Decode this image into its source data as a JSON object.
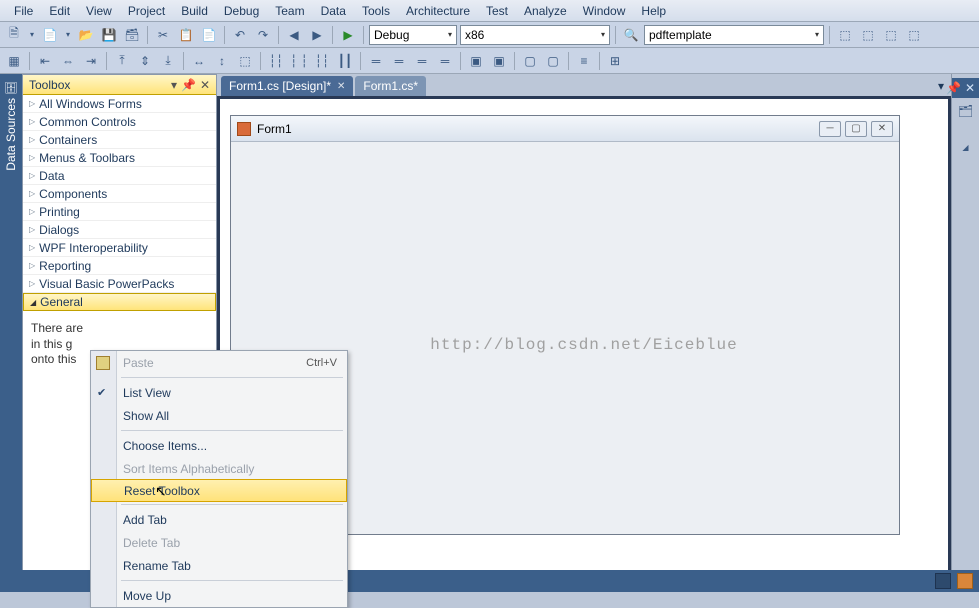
{
  "menu": {
    "items": [
      "File",
      "Edit",
      "View",
      "Project",
      "Build",
      "Debug",
      "Team",
      "Data",
      "Tools",
      "Architecture",
      "Test",
      "Analyze",
      "Window",
      "Help"
    ]
  },
  "toolbar": {
    "config": "Debug",
    "platform": "x86",
    "find": "pdftemplate"
  },
  "side_tab": {
    "label": "Data Sources"
  },
  "toolbox": {
    "title": "Toolbox",
    "categories": [
      "All Windows Forms",
      "Common Controls",
      "Containers",
      "Menus & Toolbars",
      "Data",
      "Components",
      "Printing",
      "Dialogs",
      "WPF Interoperability",
      "Reporting",
      "Visual Basic PowerPacks",
      "General"
    ],
    "empty_msg_1": "There are",
    "empty_msg_2": "in this g",
    "empty_msg_3": "onto this"
  },
  "tabs": {
    "active": "Form1.cs [Design]*",
    "inactive": "Form1.cs*"
  },
  "form": {
    "title": "Form1"
  },
  "watermark": "http://blog.csdn.net/Eiceblue",
  "ctx": {
    "paste": "Paste",
    "paste_shortcut": "Ctrl+V",
    "list_view": "List View",
    "show_all": "Show All",
    "choose_items": "Choose Items...",
    "sort": "Sort Items Alphabetically",
    "reset": "Reset Toolbox",
    "add_tab": "Add Tab",
    "delete_tab": "Delete Tab",
    "rename_tab": "Rename Tab",
    "move_up": "Move Up"
  }
}
